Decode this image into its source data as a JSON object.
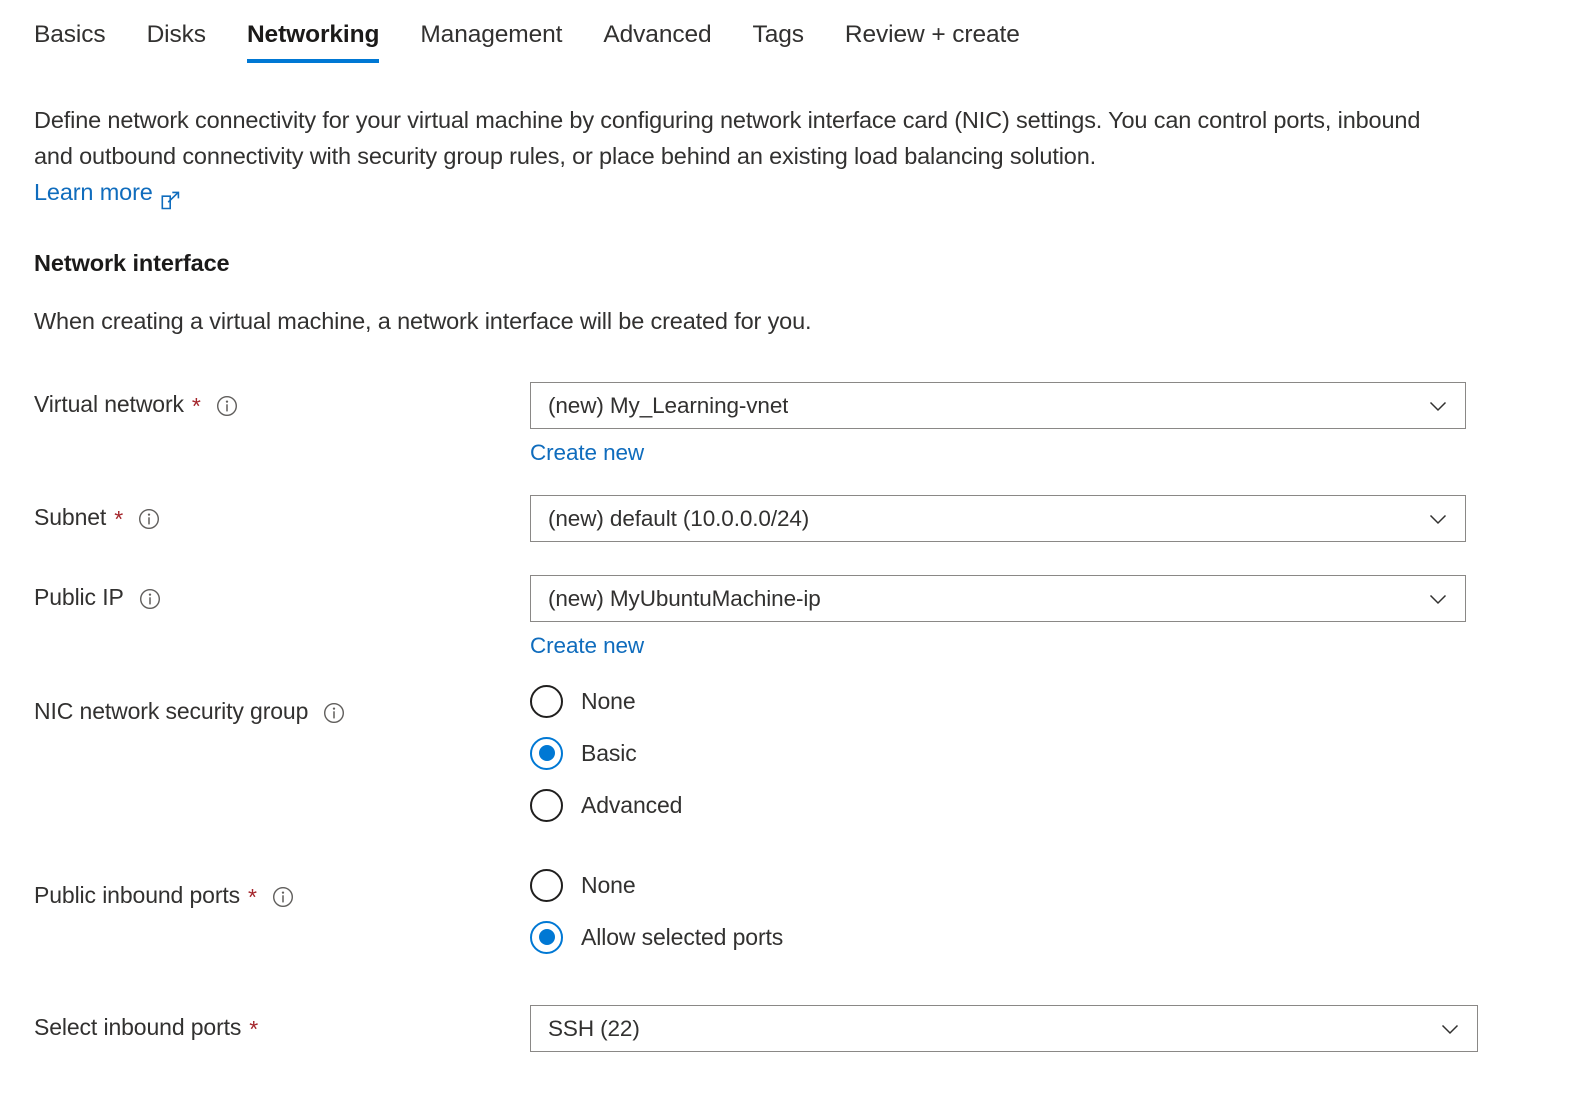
{
  "theme": {
    "accent": "#0078d4",
    "link": "#0f6cbd",
    "required_asterisk": "#a4262c",
    "text": "#323130",
    "border": "#8a8886"
  },
  "tabs": [
    {
      "label": "Basics",
      "active": false
    },
    {
      "label": "Disks",
      "active": false
    },
    {
      "label": "Networking",
      "active": true
    },
    {
      "label": "Management",
      "active": false
    },
    {
      "label": "Advanced",
      "active": false
    },
    {
      "label": "Tags",
      "active": false
    },
    {
      "label": "Review + create",
      "active": false
    }
  ],
  "intro": {
    "paragraph": "Define network connectivity for your virtual machine by configuring network interface card (NIC) settings. You can control ports, inbound and outbound connectivity with security group rules, or place behind an existing load balancing solution.",
    "learn_more": "Learn more",
    "learn_more_icon": "external-link-icon"
  },
  "section": {
    "title": "Network interface",
    "subtitle": "When creating a virtual machine, a network interface will be created for you."
  },
  "fields": {
    "virtual_network": {
      "label": "Virtual network",
      "required": true,
      "info_icon": "info-icon",
      "value": "(new) My_Learning-vnet",
      "chevron_icon": "chevron-down-icon",
      "create_new": "Create new"
    },
    "subnet": {
      "label": "Subnet",
      "required": true,
      "info_icon": "info-icon",
      "value": "(new) default (10.0.0.0/24)",
      "chevron_icon": "chevron-down-icon"
    },
    "public_ip": {
      "label": "Public IP",
      "required": false,
      "info_icon": "info-icon",
      "value": "(new) MyUbuntuMachine-ip",
      "chevron_icon": "chevron-down-icon",
      "create_new": "Create new"
    },
    "nic_nsg": {
      "label": "NIC network security group",
      "required": false,
      "info_icon": "info-icon",
      "options": [
        {
          "label": "None",
          "selected": false
        },
        {
          "label": "Basic",
          "selected": true
        },
        {
          "label": "Advanced",
          "selected": false
        }
      ]
    },
    "public_inbound_ports": {
      "label": "Public inbound ports",
      "required": true,
      "info_icon": "info-icon",
      "options": [
        {
          "label": "None",
          "selected": false
        },
        {
          "label": "Allow selected ports",
          "selected": true
        }
      ]
    },
    "select_inbound_ports": {
      "label": "Select inbound ports",
      "required": true,
      "value": "SSH (22)",
      "chevron_icon": "chevron-down-icon"
    }
  }
}
